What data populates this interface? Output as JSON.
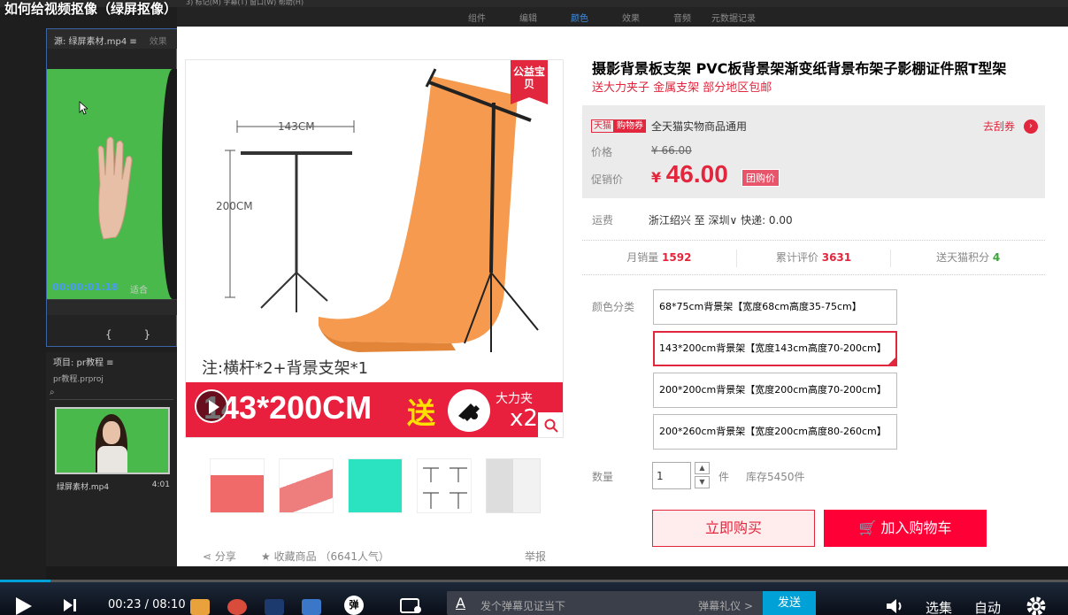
{
  "video": {
    "title": "如何给视频抠像（绿屏抠像）",
    "current_time": "00:23",
    "duration": "08:10",
    "progress": 0.047
  },
  "premiere": {
    "top_tabs": [
      "组件",
      "编辑",
      "颜色",
      "效果",
      "音频",
      "元数据记录"
    ],
    "active_tab": "颜色",
    "menu_fragments": "3)   标记(M)   字幕(T)   窗口(W)   帮助(H)",
    "source": {
      "tab_label": "源: 绿屏素材.mp4  ≡",
      "effects_tab": "效果",
      "timecode": "00:00:01:18",
      "fit": "适合",
      "controls": "{ } {←"
    },
    "project": {
      "tab_label": "项目: pr教程  ≡",
      "file": "pr教程.prproj",
      "clip_name": "绿屏素材.mp4",
      "clip_duration": "4:01"
    }
  },
  "product": {
    "title": "摄影背景板支架 PVC板背景架渐变纸背景布架子影棚证件照T型架",
    "subtitle": "送大力夹子 金属支架 部分地区包邮",
    "badge": "公益宝贝",
    "image": {
      "width_dim": "143CM",
      "height_dim": "200CM",
      "note": "注:横杆*2+背景支架*1",
      "banner_size": "143*200CM",
      "banner_send": "送",
      "banner_clip_label": "大力夹",
      "banner_qty": "x2"
    },
    "coupon": {
      "tag_tmall": "天猫",
      "tag_coupon": "购物券",
      "text": "全天猫实物商品通用",
      "link": "去刮券"
    },
    "price_label": "价格",
    "original_price": "¥ 66.00",
    "promo_label": "促销价",
    "promo_currency": "¥",
    "promo_price": "46.00",
    "group_tag": "团购价",
    "shipping": {
      "label": "运费",
      "text": "浙江绍兴 至 深圳∨ 快递: 0.00"
    },
    "stats": {
      "monthly_sales_label": "月销量",
      "monthly_sales": "1592",
      "reviews_label": "累计评价",
      "reviews": "3631",
      "points_label": "送天猫积分",
      "points": "4"
    },
    "color_label": "颜色分类",
    "skus": [
      "68*75cm背景架【宽度68cm高度35-75cm】",
      "143*200cm背景架【宽度143cm高度70-200cm】",
      "200*200cm背景架【宽度200cm高度70-200cm】",
      "200*260cm背景架【宽度200cm高度80-260cm】"
    ],
    "selected_sku_index": 1,
    "qty_label": "数量",
    "qty_value": "1",
    "qty_unit": "件",
    "stock": "库存5450件",
    "buy_now": "立即购买",
    "add_cart": "加入购物车",
    "share": "分享",
    "favorite": "收藏商品",
    "popularity": "（6641人气）",
    "report": "举报",
    "colors": {
      "tmall_red": "#e2263d",
      "cart_red": "#ff0036",
      "orange": "#f59a4e"
    }
  },
  "player": {
    "danmaku_btn": "弹",
    "danmaku_placeholder": "发个弹幕见证当下",
    "danmaku_etiquette": "弹幕礼仪 >",
    "send": "发送",
    "select": "选集",
    "auto": "自动"
  }
}
